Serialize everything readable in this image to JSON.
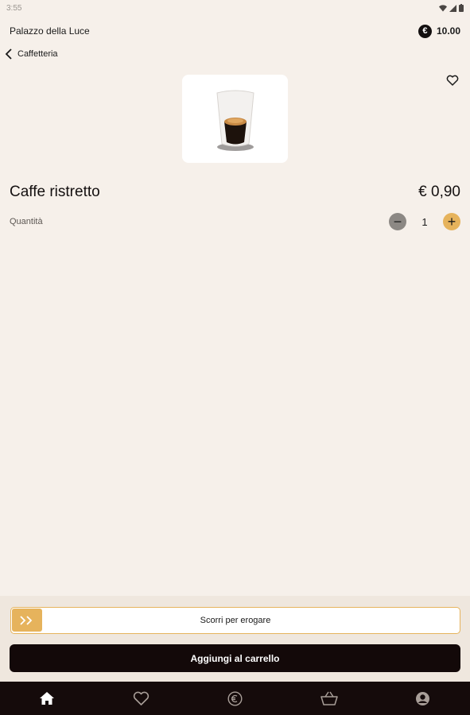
{
  "status": {
    "time": "3:55"
  },
  "header": {
    "venue": "Palazzo della Luce",
    "credit_symbol": "€",
    "credit": "10.00"
  },
  "breadcrumb": {
    "label": "Caffetteria"
  },
  "product": {
    "name": "Caffe ristretto",
    "price": "€ 0,90",
    "quantity_label": "Quantità",
    "quantity": "1",
    "minus": "−",
    "plus": "+"
  },
  "actions": {
    "swipe_label": "Scorri per erogare",
    "add_label": "Aggiungi al carrello"
  },
  "nav": {
    "items": [
      {
        "icon": "home-icon",
        "active": true
      },
      {
        "icon": "heart-icon",
        "active": false
      },
      {
        "icon": "euro-icon",
        "active": false
      },
      {
        "icon": "basket-icon",
        "active": false
      },
      {
        "icon": "user-icon",
        "active": false
      }
    ]
  },
  "colors": {
    "background": "#f6f0ea",
    "accent": "#e6b35c",
    "dark": "#130909"
  }
}
